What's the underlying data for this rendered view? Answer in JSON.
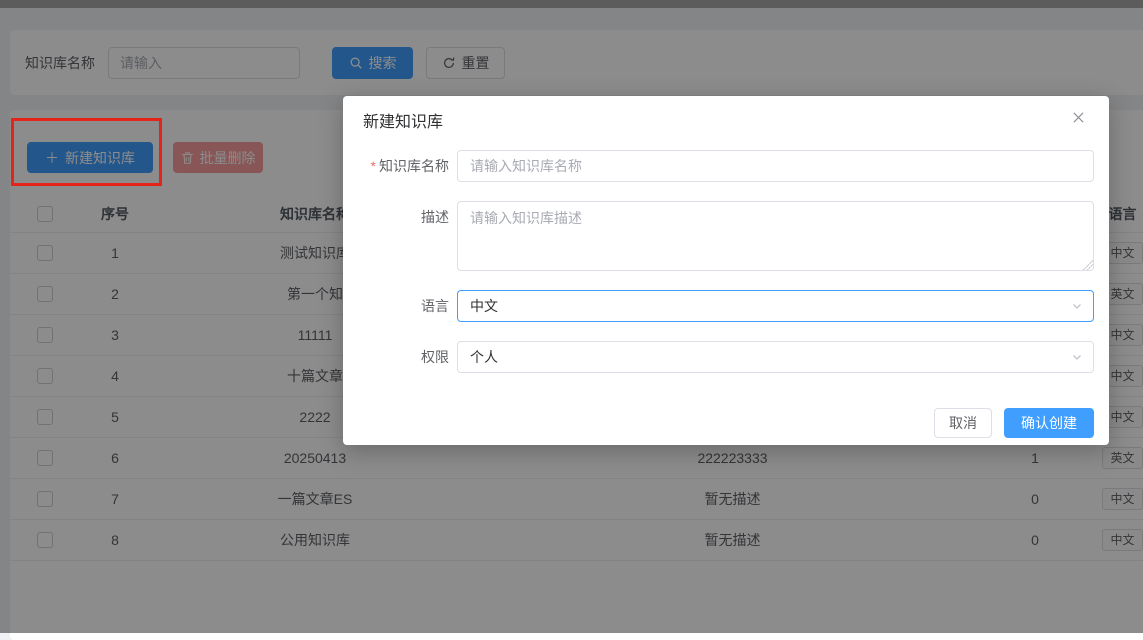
{
  "page": {
    "search_bar": {
      "label": "知识库名称",
      "input_placeholder": "请输入",
      "search_button": "搜索",
      "reset_button": "重置"
    },
    "toolbar": {
      "create_button": "新建知识库",
      "batch_delete_button": "批量删除"
    },
    "table": {
      "headers": {
        "index": "序号",
        "name": "知识库名称",
        "desc": "",
        "count": "",
        "language": "语言"
      },
      "rows": [
        {
          "index": "1",
          "name": "测试知识库",
          "desc": "",
          "count": "",
          "language": "中文"
        },
        {
          "index": "2",
          "name": "第一个知",
          "desc": "",
          "count": "",
          "language": "英文"
        },
        {
          "index": "3",
          "name": "11111",
          "desc": "",
          "count": "",
          "language": "中文"
        },
        {
          "index": "4",
          "name": "十篇文章",
          "desc": "",
          "count": "",
          "language": "中文"
        },
        {
          "index": "5",
          "name": "2222",
          "desc": "",
          "count": "",
          "language": "中文"
        },
        {
          "index": "6",
          "name": "20250413",
          "desc": "222223333",
          "count": "1",
          "language": "英文"
        },
        {
          "index": "7",
          "name": "一篇文章ES",
          "desc": "暂无描述",
          "count": "0",
          "language": "中文"
        },
        {
          "index": "8",
          "name": "公用知识库",
          "desc": "暂无描述",
          "count": "0",
          "language": "中文"
        }
      ]
    }
  },
  "modal": {
    "title": "新建知识库",
    "close_icon": "✕",
    "required_mark": "*",
    "fields": {
      "name": {
        "label": "知识库名称",
        "placeholder": "请输入知识库名称"
      },
      "desc": {
        "label": "描述",
        "placeholder": "请输入知识库描述"
      },
      "language": {
        "label": "语言",
        "value": "中文"
      },
      "permission": {
        "label": "权限",
        "value": "个人"
      }
    },
    "cancel_button": "取消",
    "confirm_button": "确认创建"
  },
  "icons": {
    "search": "magnifier",
    "reset": "refresh-arrow",
    "create": "plus",
    "create_glyph": "＋",
    "batch_delete": "trash",
    "select_arrow": "chevron-down"
  },
  "colors": {
    "primary": "#409EFF",
    "danger_disabled": "#F89898",
    "annotation_red": "#E6231B",
    "overlay": "rgba(0,0,0,0.45)",
    "page_background": "#F0F2F5"
  }
}
